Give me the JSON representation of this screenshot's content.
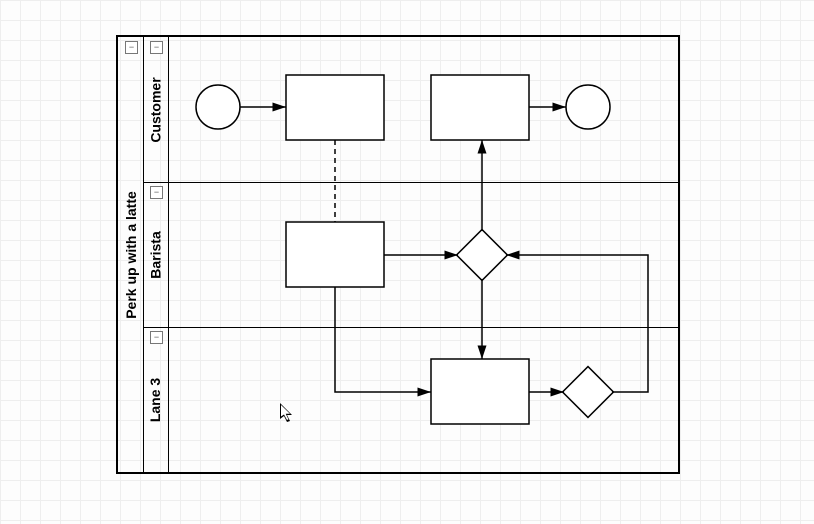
{
  "pool": {
    "title": "Perk up with a latte",
    "collapse_glyph": "−"
  },
  "lanes": [
    {
      "id": "customer",
      "title": "Customer",
      "collapse_glyph": "−"
    },
    {
      "id": "barista",
      "title": "Barista",
      "collapse_glyph": "−"
    },
    {
      "id": "lane3",
      "title": "Lane 3",
      "collapse_glyph": "−"
    }
  ],
  "chart_data": {
    "type": "bpmn-swimlane",
    "pool": "Perk up with a latte",
    "lanes": [
      "Customer",
      "Barista",
      "Lane 3"
    ],
    "nodes": [
      {
        "id": "start",
        "lane": "Customer",
        "kind": "start-event"
      },
      {
        "id": "taskC1",
        "lane": "Customer",
        "kind": "task"
      },
      {
        "id": "taskC2",
        "lane": "Customer",
        "kind": "task"
      },
      {
        "id": "end",
        "lane": "Customer",
        "kind": "end-event"
      },
      {
        "id": "taskB1",
        "lane": "Barista",
        "kind": "task"
      },
      {
        "id": "gwB",
        "lane": "Barista",
        "kind": "gateway"
      },
      {
        "id": "taskL1",
        "lane": "Lane 3",
        "kind": "task"
      },
      {
        "id": "gwL",
        "lane": "Lane 3",
        "kind": "gateway"
      }
    ],
    "edges": [
      {
        "from": "start",
        "to": "taskC1",
        "kind": "sequence"
      },
      {
        "from": "taskC2",
        "to": "end",
        "kind": "sequence"
      },
      {
        "from": "taskC1",
        "to": "taskB1",
        "kind": "message"
      },
      {
        "from": "taskB1",
        "to": "gwB",
        "kind": "sequence"
      },
      {
        "from": "gwB",
        "to": "taskC2",
        "kind": "sequence"
      },
      {
        "from": "gwB",
        "to": "taskL1",
        "kind": "sequence"
      },
      {
        "from": "taskB1",
        "to": "taskL1",
        "kind": "sequence",
        "route": "down-right"
      },
      {
        "from": "taskL1",
        "to": "gwL",
        "kind": "sequence"
      },
      {
        "from": "gwL",
        "to": "gwB",
        "kind": "sequence",
        "route": "right-up-left"
      }
    ]
  }
}
